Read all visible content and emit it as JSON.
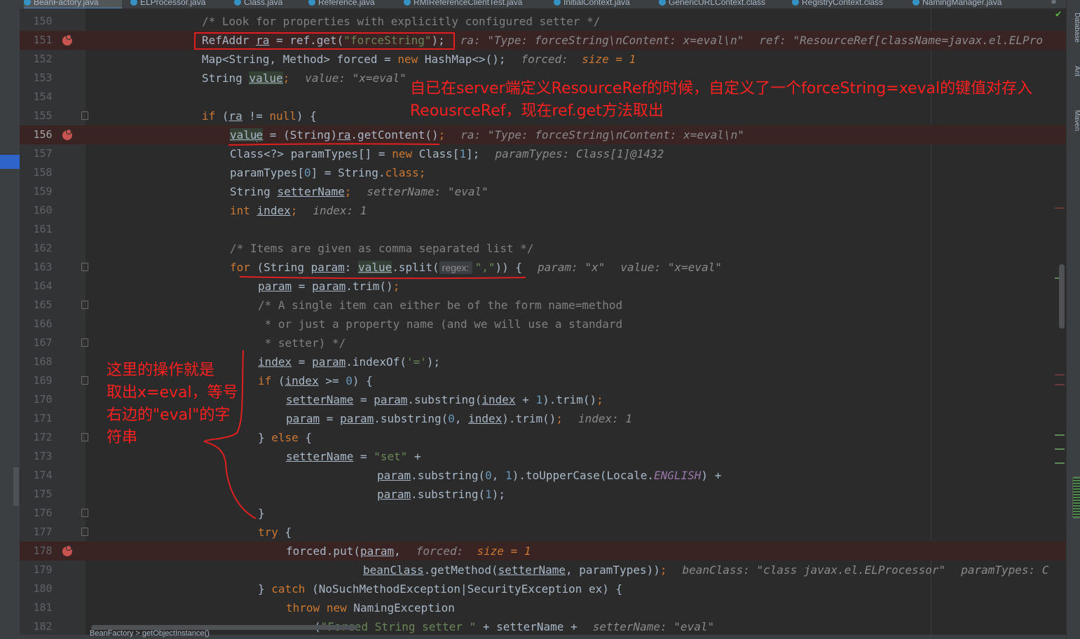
{
  "tabs": [
    {
      "label": "BeanFactory.java",
      "active": true
    },
    {
      "label": "ELProcessor.java"
    },
    {
      "label": "Class.java"
    },
    {
      "label": "Reference.java"
    },
    {
      "label": "RMIReferenceClientTest.java"
    },
    {
      "label": "InitialContext.java"
    },
    {
      "label": "GenericURLContext.class"
    },
    {
      "label": "RegistryContext.class"
    },
    {
      "label": "NamingManager.java"
    }
  ],
  "tab_menu": "≡",
  "right_tools": {
    "database": "Database",
    "ant": "Ant",
    "maven": "Maven"
  },
  "annotations": {
    "top": [
      "自已在server端定义ResourceRef的时候，自定义了一个forceString=xeval的键值对存入",
      "ReousrceRef，现在ref.get方法取出"
    ],
    "left": [
      "这里的操作就是",
      "取出x=eval，等号",
      "右边的\"eval\"的字",
      "符串"
    ]
  },
  "code": {
    "c150": "/* Look for properties with explicitly configured setter */",
    "c152a": "Map<String, Method> forced = ",
    "c152b": "new",
    "c152c": " HashMap<>();",
    "h152a": "forced:",
    "h152b": "size = 1",
    "c153a": "String ",
    "c153b": "value",
    "c153c": ";",
    "h153": "value: \"x=eval\"",
    "c155a": "if",
    "c155b": " (",
    "c155c": "ra",
    "c155d": " != ",
    "c155e": "null",
    "c155f": ") {",
    "c156a": "valu",
    "c156b": "e",
    "c156c": " = (String)",
    "c156d": "ra",
    "c156e": ".getContent()",
    "c156f": ";",
    "h156": "ra: \"Type: forceString\\nContent: x=eval\\n\"",
    "c157a": "Class<?> paramTypes[] = ",
    "c157b": "new",
    "c157c": " Class[",
    "c157d": "1",
    "c157e": "];",
    "h157": "paramTypes: Class[1]@1432",
    "c158a": "paramTypes[",
    "c158b": "0",
    "c158c": "] = String.",
    "c158d": "class",
    "c158e": ";",
    "c159a": "String ",
    "c159b": "setterName",
    "c159c": ";",
    "h159": "setterName: \"eval\"",
    "c160a": "int",
    "c160b": " ",
    "c160c": "index",
    "c160d": ";",
    "h160": "index: 1",
    "c162": "/* Items are given as comma separated list */",
    "c163a": "for",
    "c163b": " (String ",
    "c163c": "param",
    "c163d": ": ",
    "c163e": "value",
    "c163f": ".split(",
    "c163g": "regex:",
    "c163h": "\",\"",
    "c163i": ")) {",
    "h163a": "param: \"x\"",
    "h163b": "value: \"x=eval\"",
    "c164a": "param",
    "c164b": " = ",
    "c164c": "param",
    "c164d": ".trim()",
    "c164e": ";",
    "c165": "/* A single item can either be of the form name=method",
    "c166": " * or just a property name (and we will use a standard",
    "c167": " * setter) */",
    "c168a": "index",
    "c168b": " = ",
    "c168c": "param",
    "c168d": ".indexOf(",
    "c168e": "'='",
    "c168f": ");",
    "c169a": "if",
    "c169b": " (",
    "c169c": "index",
    "c169d": " >= ",
    "c169e": "0",
    "c169f": ") {",
    "c170a": "setterName",
    "c170b": " = ",
    "c170c": "param",
    "c170d": ".substring(",
    "c170e": "index",
    "c170f": " + ",
    "c170g": "1",
    "c170h": ").trim()",
    "c170i": ";",
    "c171a": "param",
    "c171b": " = ",
    "c171c": "param",
    "c171d": ".substring(",
    "c171e": "0",
    "c171f": ", ",
    "c171g": "index",
    "c171h": ").trim()",
    "c171i": ";",
    "h171": "index: 1",
    "c172a": "} ",
    "c172b": "else",
    "c172c": " {",
    "c173a": "setterName",
    "c173b": " = ",
    "c173c": "\"set\"",
    "c173d": " +",
    "c174a": "param",
    "c174b": ".substring(",
    "c174c": "0",
    "c174d": ", ",
    "c174e": "1",
    "c174f": ").toUpperCase(Locale.",
    "c174g": "ENGLISH",
    "c174h": ") +",
    "c175a": "param",
    "c175b": ".substring(",
    "c175c": "1",
    "c175d": ");",
    "c176": "}",
    "c177a": "try",
    "c177b": " {",
    "c178a": "forced.put(",
    "c178b": "param",
    "c178c": ",",
    "h178a": "forced:",
    "h178b": "size = 1",
    "c179a": "beanClass",
    "c179b": ".getMethod(",
    "c179c": "setterName",
    "c179d": ", paramTypes))",
    "c179e": ";",
    "h179a": "beanClass: \"class javax.el.ELProcessor\"",
    "h179b": "paramTypes: C",
    "c180a": "} ",
    "c180b": "catch",
    "c180c": " (NoSuchMethodException|SecurityException ex) {",
    "c181a": "throw",
    "c181b": " ",
    "c181c": "new",
    "c181d": " NamingException",
    "c182a": "(",
    "c182b": "\"Forced String setter \"",
    "c182c": " + setterName +",
    "h182": "setterName: \"eval\"",
    "c151a": "RefAddr ",
    "c151b": "ra",
    "c151c": " = ref.get(",
    "c151d": "\"forceString\"",
    "c151e": ");",
    "h151a": "ra: \"Type: forceString\\nContent: x=eval\\n\"",
    "h151b": "ref: \"ResourceRef[className=javax.el.ELPro"
  },
  "line_numbers": {
    "n150": "150",
    "n151": "151",
    "n152": "152",
    "n153": "153",
    "n154": "154",
    "n155": "155",
    "n156": "156",
    "n157": "157",
    "n158": "158",
    "n159": "159",
    "n160": "160",
    "n161": "161",
    "n162": "162",
    "n163": "163",
    "n164": "164",
    "n165": "165",
    "n166": "166",
    "n167": "167",
    "n168": "168",
    "n169": "169",
    "n170": "170",
    "n171": "171",
    "n172": "172",
    "n173": "173",
    "n174": "174",
    "n175": "175",
    "n176": "176",
    "n177": "177",
    "n178": "178",
    "n179": "179",
    "n180": "180",
    "n181": "181",
    "n182": "182"
  },
  "status_bar": "BeanFactory > getObjectInstance()",
  "colors": {
    "breakpoint": "#c75450",
    "annotation": "#ff2020",
    "keyword": "#cc7832",
    "string": "#6a8759"
  }
}
